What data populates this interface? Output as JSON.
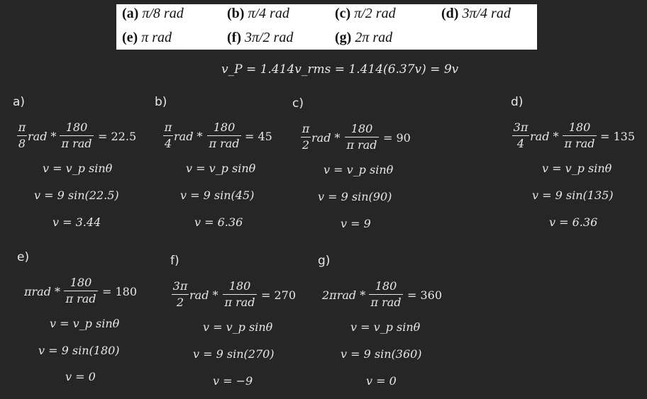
{
  "problem": {
    "options": [
      {
        "letter": "(a)",
        "value": "π/8 rad"
      },
      {
        "letter": "(b)",
        "value": "π/4 rad"
      },
      {
        "letter": "(c)",
        "value": "π/2 rad"
      },
      {
        "letter": "(d)",
        "value": "3π/4 rad"
      },
      {
        "letter": "(e)",
        "value": "π rad"
      },
      {
        "letter": "(f)",
        "value": "3π/2 rad"
      },
      {
        "letter": "(g)",
        "value": "2π rad"
      }
    ]
  },
  "vp_equation": "v_P = 1.414v_rms = 1.414(6.37v) = 9v",
  "parts": [
    {
      "label": "a)",
      "angle_num": "π",
      "angle_den": "8",
      "angle_suffix": "rad *",
      "conv_num": "180",
      "conv_den": "π rad",
      "result": "= 22.5",
      "line1": "v = v_p sinθ",
      "line2": "v = 9 sin(22.5)",
      "line3": "v = 3.44"
    },
    {
      "label": "b)",
      "angle_num": "π",
      "angle_den": "4",
      "angle_suffix": "rad *",
      "conv_num": "180",
      "conv_den": "π rad",
      "result": "= 45",
      "line1": "v = v_p sinθ",
      "line2": "v = 9 sin(45)",
      "line3": "v = 6.36"
    },
    {
      "label": "c)",
      "angle_num": "π",
      "angle_den": "2",
      "angle_suffix": "rad *",
      "conv_num": "180",
      "conv_den": "π rad",
      "result": "= 90",
      "line1": "v = v_p sinθ",
      "line2": "v = 9 sin(90)",
      "line3": "v = 9"
    },
    {
      "label": "d)",
      "angle_num": "3π",
      "angle_den": "4",
      "angle_suffix": "rad *",
      "conv_num": "180",
      "conv_den": "π rad",
      "result": "= 135",
      "line1": "v = v_p sinθ",
      "line2": "v = 9 sin(135)",
      "line3": "v = 6.36"
    },
    {
      "label": "e)",
      "angle_prefix": "πrad *",
      "conv_num": "180",
      "conv_den": "π rad",
      "result": "= 180",
      "line1": "v = v_p sinθ",
      "line2": "v = 9 sin(180)",
      "line3": "v = 0"
    },
    {
      "label": "f)",
      "angle_num": "3π",
      "angle_den": "2",
      "angle_suffix": "rad *",
      "conv_num": "180",
      "conv_den": "π rad",
      "result": "= 270",
      "line1": "v = v_p sinθ",
      "line2": "v = 9 sin(270)",
      "line3": "v = −9"
    },
    {
      "label": "g)",
      "angle_prefix": "2πrad *",
      "conv_num": "180",
      "conv_den": "π rad",
      "result": "= 360",
      "line1": "v = v_p sinθ",
      "line2": "v = 9 sin(360)",
      "line3": "v = 0"
    }
  ]
}
